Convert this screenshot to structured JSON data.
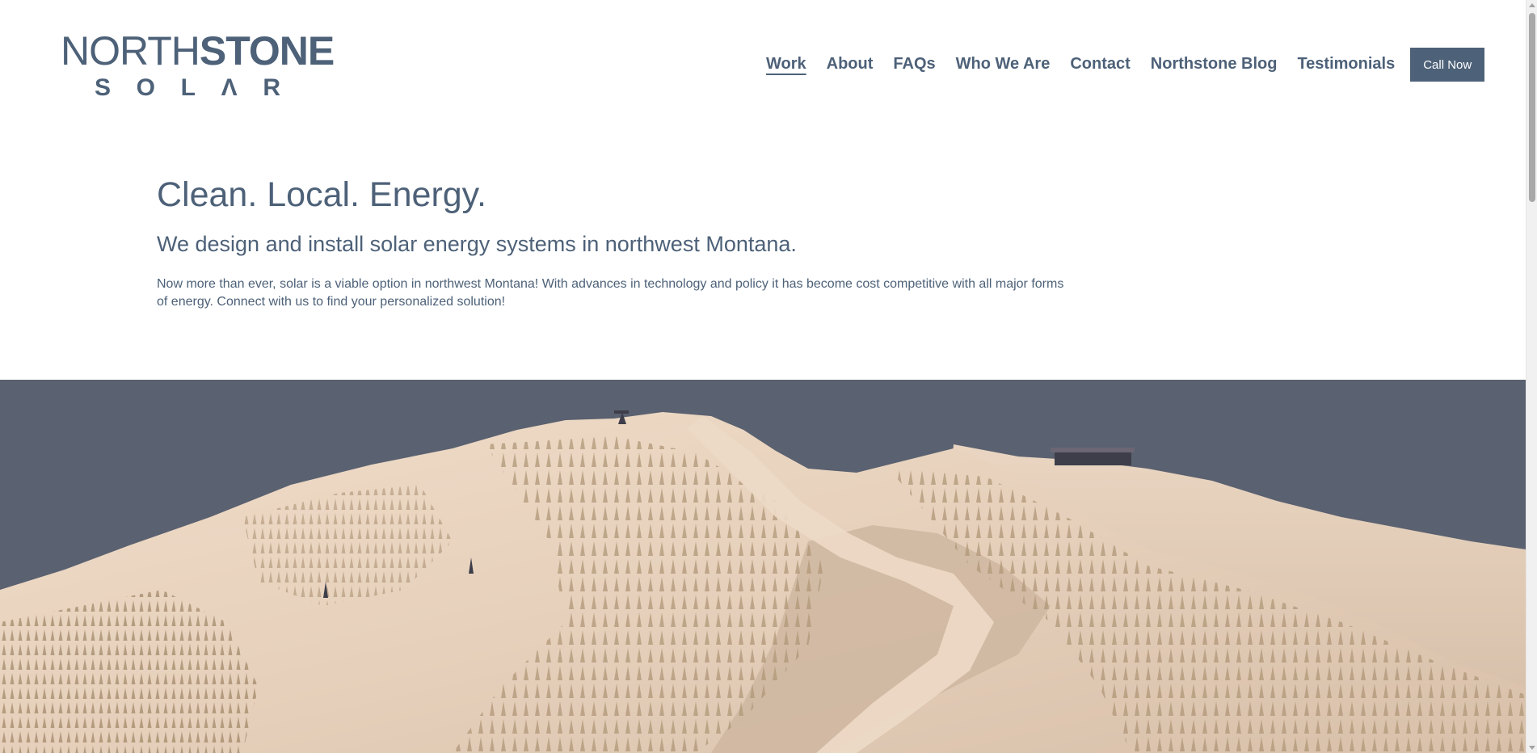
{
  "logo": {
    "word_light": "NORTH",
    "word_bold": "STONE",
    "sub_letters": [
      "S",
      "O",
      "L",
      "Λ",
      "R"
    ]
  },
  "nav": {
    "items": [
      {
        "label": "Work",
        "active": true
      },
      {
        "label": "About"
      },
      {
        "label": "FAQs"
      },
      {
        "label": "Who We Are"
      },
      {
        "label": "Contact"
      },
      {
        "label": "Northstone Blog"
      },
      {
        "label": "Testimonials"
      }
    ],
    "cta_label": "Call Now"
  },
  "intro": {
    "headline": "Clean. Local. Energy.",
    "subheadline": "We design and install solar energy systems in northwest Montana.",
    "body": "Now more than ever, solar is a viable option in northwest Montana! With advances in technology and policy it has become cost competitive with all major forms of energy. Connect with us to find your personalized solution!"
  },
  "hero": {
    "image": "snow-covered-mountain-with-frosted-trees"
  },
  "colors": {
    "brand": "#4d6178",
    "sky": "#5a6170",
    "snow_light": "#e8d6c4",
    "snow_shadow": "#c9b4a0",
    "trees": "#b39c7e"
  }
}
